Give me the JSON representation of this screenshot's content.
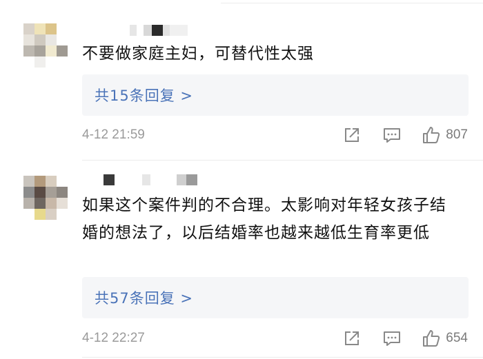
{
  "comments": [
    {
      "username": "",
      "text": "不要做家庭主妇，可替代性太强",
      "reply_link": "共15条回复 >",
      "timestamp": "4-12 21:59",
      "like_count": "807"
    },
    {
      "username": "",
      "text": "如果这个案件判的不合理。太影响对年轻女孩子结婚的想法了，以后结婚率也越来越低生育率更低",
      "reply_link": "共57条回复 >",
      "timestamp": "4-12 22:27",
      "like_count": "654"
    }
  ],
  "icons": {
    "share": "share-icon",
    "comment": "comment-icon",
    "like": "thumbs-up-icon"
  },
  "colors": {
    "link": "#4a73b8",
    "reply_bg": "#f5f6f8",
    "meta": "#9a9a9a",
    "icon": "#888888"
  }
}
